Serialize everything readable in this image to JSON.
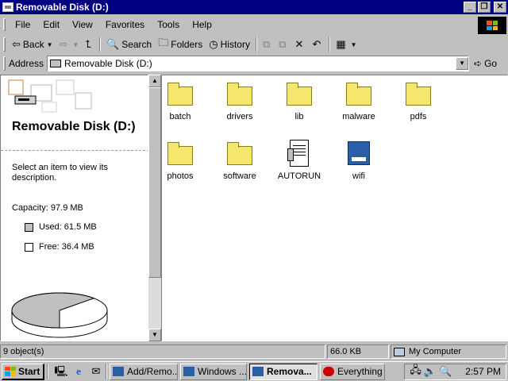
{
  "window": {
    "title": "Removable Disk (D:)"
  },
  "menu": [
    "File",
    "Edit",
    "View",
    "Favorites",
    "Tools",
    "Help"
  ],
  "toolbar": {
    "back": "Back",
    "search": "Search",
    "folders": "Folders",
    "history": "History"
  },
  "address": {
    "label": "Address",
    "value": "Removable Disk (D:)",
    "go": "Go"
  },
  "leftpane": {
    "title": "Removable Disk (D:)",
    "hint": "Select an item to view its description.",
    "capacity": "Capacity: 97.9 MB",
    "used": "Used: 61.5 MB",
    "free": "Free: 36.4 MB",
    "used_fraction": 0.628,
    "colors": {
      "used": "#c0c0c0",
      "free": "#ffffff"
    }
  },
  "files": [
    {
      "name": "batch",
      "type": "folder"
    },
    {
      "name": "drivers",
      "type": "folder"
    },
    {
      "name": "lib",
      "type": "folder"
    },
    {
      "name": "malware",
      "type": "folder"
    },
    {
      "name": "pdfs",
      "type": "folder"
    },
    {
      "name": "photos",
      "type": "folder"
    },
    {
      "name": "software",
      "type": "folder"
    },
    {
      "name": "AUTORUN",
      "type": "doc"
    },
    {
      "name": "wifi",
      "type": "app"
    }
  ],
  "status": {
    "objects": "9 object(s)",
    "size": "66.0 KB",
    "zone": "My Computer"
  },
  "taskbar": {
    "start": "Start",
    "tasks": [
      {
        "label": "Add/Remo...",
        "active": false
      },
      {
        "label": "Windows ...",
        "active": false
      },
      {
        "label": "Remova...",
        "active": true
      },
      {
        "label": "Everything",
        "active": false
      }
    ],
    "clock": "2:57 PM"
  }
}
